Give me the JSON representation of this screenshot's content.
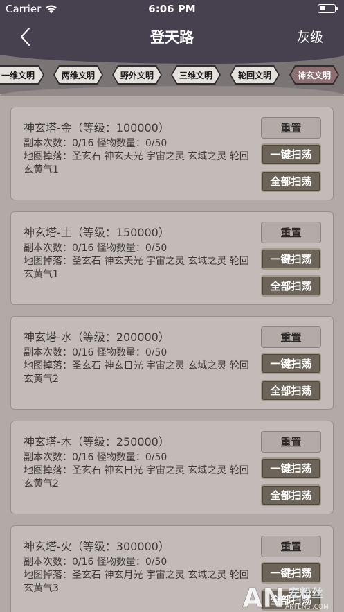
{
  "status": {
    "carrier": "Carrier",
    "time": "6:06 PM"
  },
  "nav": {
    "title": "登天路",
    "right_label": "灰级"
  },
  "tabs": [
    {
      "label": "一维文明",
      "active": false
    },
    {
      "label": "两维文明",
      "active": false
    },
    {
      "label": "野外文明",
      "active": false
    },
    {
      "label": "三维文明",
      "active": false
    },
    {
      "label": "轮回文明",
      "active": false
    },
    {
      "label": "神玄文明",
      "active": true
    }
  ],
  "buttons": {
    "reset": "重置",
    "one_sweep": "一键扫荡",
    "all_sweep": "全部扫荡"
  },
  "cards": [
    {
      "name": "神玄塔-金（等级：100000）",
      "counts": "副本次数：0/16   怪物数量：0/50",
      "drops": "地图掉落：圣玄石 神玄天光 宇宙之灵 玄域之灵 轮回玄黄气1"
    },
    {
      "name": "神玄塔-土（等级：150000）",
      "counts": "副本次数：0/16   怪物数量：0/50",
      "drops": "地图掉落：圣玄石 神玄天光 宇宙之灵 玄域之灵 轮回玄黄气1"
    },
    {
      "name": "神玄塔-水（等级：200000）",
      "counts": "副本次数：0/16   怪物数量：0/50",
      "drops": "地图掉落：圣玄石 神玄日光 宇宙之灵 玄域之灵 轮回玄黄气2"
    },
    {
      "name": "神玄塔-木（等级：250000）",
      "counts": "副本次数：0/16   怪物数量：0/50",
      "drops": "地图掉落：圣玄石 神玄日光 宇宙之灵 玄域之灵 轮回玄黄气2"
    },
    {
      "name": "神玄塔-火（等级：300000）",
      "counts": "副本次数：0/16   怪物数量：0/50",
      "drops": "地图掉落：圣玄石 神玄月光 宇宙之灵 玄域之灵 轮回玄黄气3"
    }
  ],
  "watermark": {
    "text": "安粉丝",
    "sub": "ANFENSI.COM",
    "logo": "AN"
  },
  "colors": {
    "header": "#46404f",
    "page_bg": "#b1aaa7",
    "card_bg": "#c2bbb7",
    "sweep_button": "#6c6458",
    "active_tab": "#8c6e70"
  }
}
